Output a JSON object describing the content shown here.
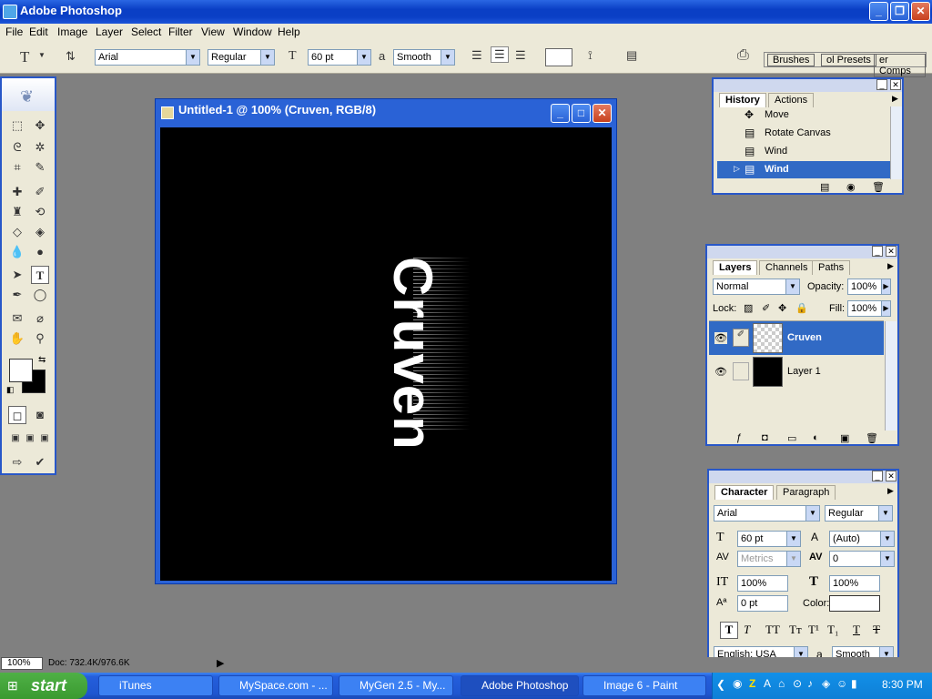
{
  "app": {
    "title": "Adobe Photoshop"
  },
  "menu": [
    "File",
    "Edit",
    "Image",
    "Layer",
    "Select",
    "Filter",
    "View",
    "Window",
    "Help"
  ],
  "options": {
    "font_family": "Arial",
    "font_style": "Regular",
    "font_size": "60 pt",
    "aa_label": "a",
    "antialias": "Smooth",
    "wells": [
      "Brushes",
      "ol Presets",
      "er Comps"
    ]
  },
  "document": {
    "title": "Untitled-1 @ 100% (Cruven, RGB/8)",
    "text": "Cruven"
  },
  "history": {
    "tabs": [
      "History",
      "Actions"
    ],
    "items": [
      "Move",
      "Rotate Canvas",
      "Wind",
      "Wind"
    ]
  },
  "layers": {
    "tabs": [
      "Layers",
      "Channels",
      "Paths"
    ],
    "blend": "Normal",
    "opacity_label": "Opacity:",
    "opacity": "100%",
    "lock_label": "Lock:",
    "fill_label": "Fill:",
    "fill": "100%",
    "items": [
      "Cruven",
      "Layer 1"
    ]
  },
  "character": {
    "tabs": [
      "Character",
      "Paragraph"
    ],
    "font": "Arial",
    "style": "Regular",
    "size": "60 pt",
    "leading": "(Auto)",
    "kerning": "Metrics",
    "tracking": "0",
    "vscale": "100%",
    "hscale": "100%",
    "baseline": "0 pt",
    "color_label": "Color:",
    "language": "English: USA",
    "aa_label": "a",
    "antialias": "Smooth"
  },
  "status": {
    "zoom": "100%",
    "doc": "Doc: 732.4K/976.6K"
  },
  "taskbar": {
    "start": "start",
    "tasks": [
      "iTunes",
      "MySpace.com - ...",
      "MyGen 2.5 - My...",
      "Adobe Photoshop",
      "Image 6 - Paint"
    ],
    "clock": "8:30 PM"
  }
}
